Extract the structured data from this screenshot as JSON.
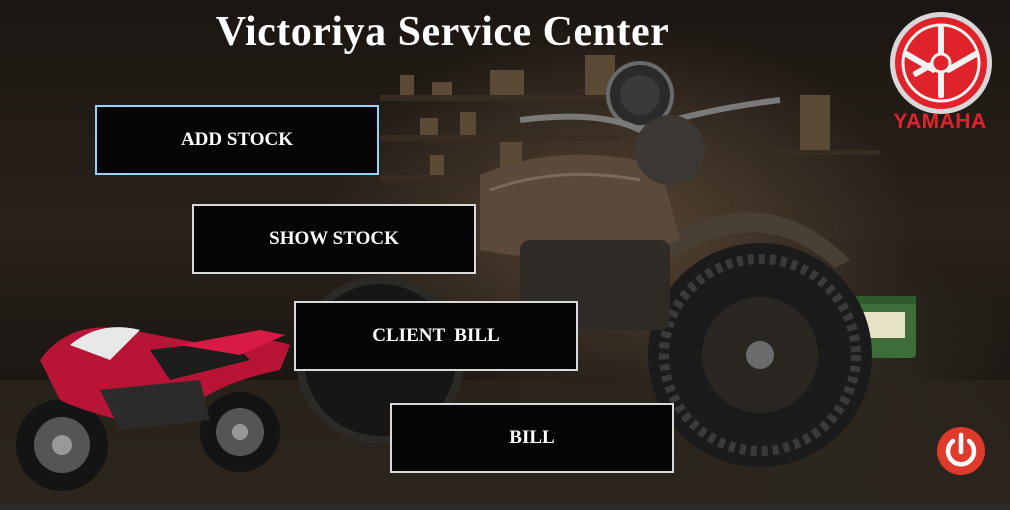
{
  "app": {
    "title": "Victoriya Service Center"
  },
  "menu": {
    "add_stock": "ADD STOCK",
    "show_stock": "SHOW STOCK",
    "client_bill": "CLIENT  BILL",
    "bill": "BILL"
  },
  "brand": {
    "name": "YAMAHA",
    "color": "#e0232b"
  },
  "icons": {
    "logo": "yamaha-tuning-fork-icon",
    "power": "power-icon"
  },
  "colors": {
    "button_bg": "#050505",
    "button_border": "#d9d9d9",
    "active_border": "#8fd3ff",
    "title_text": "#ffffff"
  }
}
